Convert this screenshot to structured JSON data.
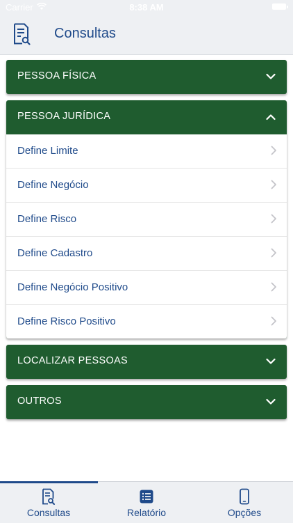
{
  "status_bar": {
    "carrier": "Carrier",
    "time": "8:38 AM"
  },
  "header": {
    "title": "Consultas"
  },
  "sections": [
    {
      "label": "PESSOA FÍSICA",
      "expanded": false
    },
    {
      "label": "PESSOA JURÍDICA",
      "expanded": true,
      "items": [
        "Define Limite",
        "Define Negócio",
        "Define Risco",
        "Define Cadastro",
        "Define Negócio Positivo",
        "Define Risco Positivo"
      ]
    },
    {
      "label": "LOCALIZAR PESSOAS",
      "expanded": false
    },
    {
      "label": "OUTROS",
      "expanded": false
    }
  ],
  "tabs": [
    {
      "label": "Consultas",
      "icon": "document-search-icon",
      "active": true
    },
    {
      "label": "Relatório",
      "icon": "list-icon",
      "active": false
    },
    {
      "label": "Opções",
      "icon": "phone-icon",
      "active": false
    }
  ],
  "colors": {
    "accent": "#1f4a8a",
    "section_bg": "#1f5c2f",
    "bar_bg": "#eef0f3"
  }
}
